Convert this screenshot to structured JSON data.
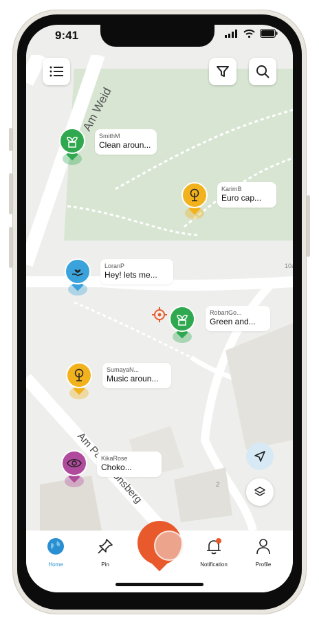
{
  "status_bar": {
    "time": "9:41"
  },
  "map": {
    "street_labels": [
      "Am Weid",
      "Am Pantaleonsberg"
    ],
    "numbers": [
      "10a",
      "2"
    ]
  },
  "posts": [
    {
      "user": "SmithM",
      "message": "Clean aroun...",
      "icon": "plant-icon",
      "color": "#2fa84f"
    },
    {
      "user": "KarimB",
      "message": "Euro cap...",
      "icon": "tree-icon",
      "color": "#f2b21d"
    },
    {
      "user": "LoranP",
      "message": "Hey! lets me...",
      "icon": "heart-hand-icon",
      "color": "#3aa3dc"
    },
    {
      "user": "RobartGo...",
      "message": "Green and...",
      "icon": "plant-icon",
      "color": "#2fa84f"
    },
    {
      "user": "SumayaN...",
      "message": "Music aroun...",
      "icon": "tree-icon",
      "color": "#f2b21d"
    },
    {
      "user": "KikaRose",
      "message": "Choko...",
      "icon": "eye-icon",
      "color": "#b04a9c"
    }
  ],
  "nav": {
    "items": [
      {
        "label": "Home",
        "icon": "globe-icon",
        "active": true
      },
      {
        "label": "Pin",
        "icon": "pin-icon"
      },
      {
        "label": "Notification",
        "icon": "bell-icon"
      },
      {
        "label": "Profile",
        "icon": "user-icon"
      }
    ]
  },
  "colors": {
    "accent": "#e85a2c",
    "active_nav": "#2a8fd1",
    "map_green": "#d7e5d2",
    "map_bg": "#eeeeec"
  }
}
